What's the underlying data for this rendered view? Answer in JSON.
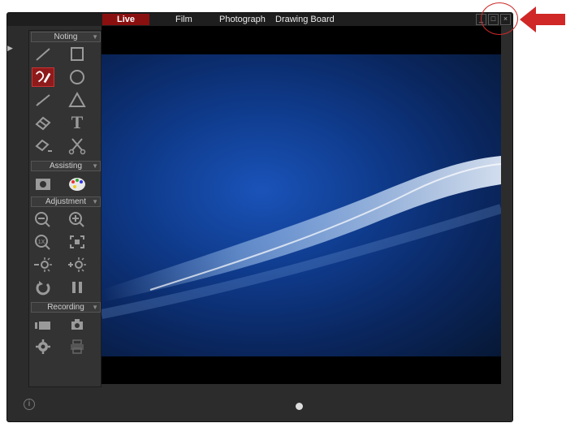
{
  "tabs": [
    {
      "label": "Live",
      "active": true
    },
    {
      "label": "Film",
      "active": false
    },
    {
      "label": "Photograph",
      "active": false
    },
    {
      "label": "Drawing Board",
      "active": false
    }
  ],
  "window_controls": {
    "minimize": "_",
    "restore": "□",
    "close": "×"
  },
  "toolbar": {
    "sections": {
      "noting": "Noting",
      "assisting": "Assisting",
      "adjustment": "Adjustment",
      "recording": "Recording"
    },
    "noting_tools": [
      "line-tool",
      "rectangle-tool",
      "freehand-pen-tool",
      "circle-tool",
      "arrow-tool",
      "triangle-tool",
      "eraser-tool",
      "text-tool",
      "clear-all-tool",
      "scissors-tool"
    ],
    "text_tool_glyph": "T",
    "assisting_tools": [
      "mask-tool",
      "color-palette-tool"
    ],
    "adjustment_tools": [
      "zoom-out",
      "zoom-in",
      "zoom-1x",
      "zoom-fit",
      "brightness-down",
      "brightness-up",
      "rotate",
      "pause"
    ],
    "zoom_1x_label": "1X",
    "recording_tools": [
      "video-record",
      "photo-capture",
      "settings",
      "print"
    ]
  },
  "colors": {
    "active_tab": "#8a1010",
    "annotation": "#cc2a2a"
  }
}
